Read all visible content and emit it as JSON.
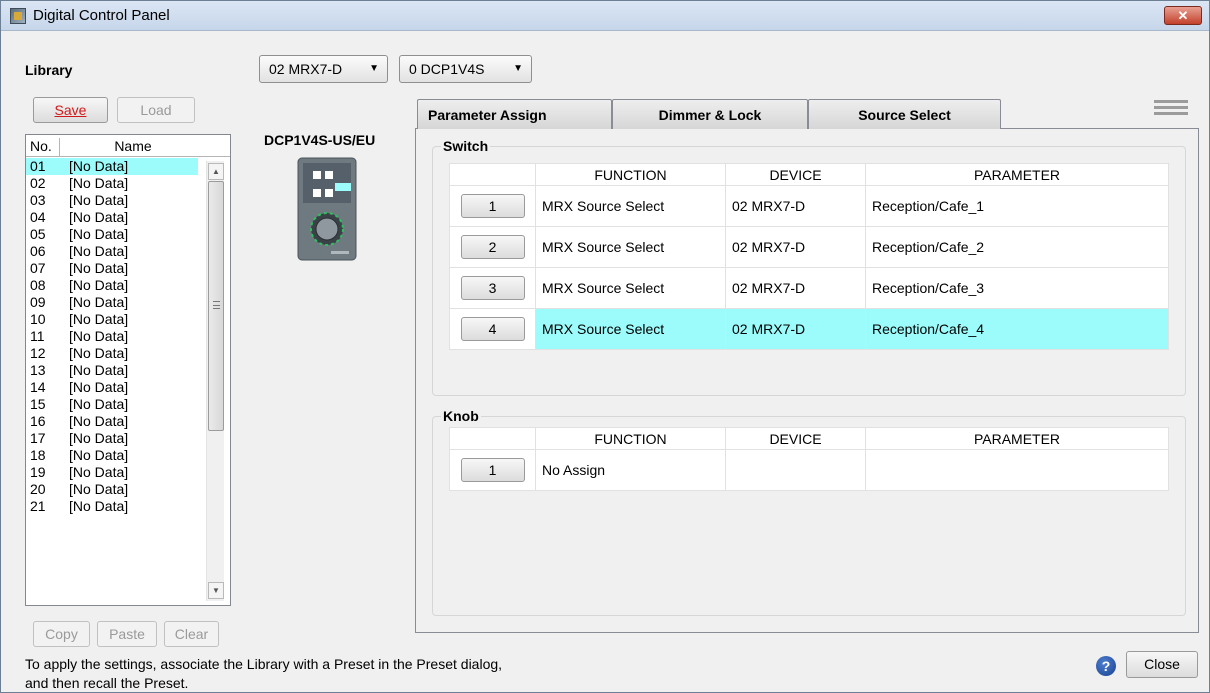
{
  "window": {
    "title": "Digital Control Panel",
    "close_glyph": "✕"
  },
  "library": {
    "label": "Library",
    "save_label": "Save",
    "load_label": "Load",
    "columns": {
      "no": "No.",
      "name": "Name"
    },
    "rows": [
      {
        "no": "01",
        "name": "[No Data]"
      },
      {
        "no": "02",
        "name": "[No Data]"
      },
      {
        "no": "03",
        "name": "[No Data]"
      },
      {
        "no": "04",
        "name": "[No Data]"
      },
      {
        "no": "05",
        "name": "[No Data]"
      },
      {
        "no": "06",
        "name": "[No Data]"
      },
      {
        "no": "07",
        "name": "[No Data]"
      },
      {
        "no": "08",
        "name": "[No Data]"
      },
      {
        "no": "09",
        "name": "[No Data]"
      },
      {
        "no": "10",
        "name": "[No Data]"
      },
      {
        "no": "11",
        "name": "[No Data]"
      },
      {
        "no": "12",
        "name": "[No Data]"
      },
      {
        "no": "13",
        "name": "[No Data]"
      },
      {
        "no": "14",
        "name": "[No Data]"
      },
      {
        "no": "15",
        "name": "[No Data]"
      },
      {
        "no": "16",
        "name": "[No Data]"
      },
      {
        "no": "17",
        "name": "[No Data]"
      },
      {
        "no": "18",
        "name": "[No Data]"
      },
      {
        "no": "19",
        "name": "[No Data]"
      },
      {
        "no": "20",
        "name": "[No Data]"
      },
      {
        "no": "21",
        "name": "[No Data]"
      }
    ],
    "selected_row": "01",
    "copy_label": "Copy",
    "paste_label": "Paste",
    "clear_label": "Clear"
  },
  "selectors": {
    "device": "02 MRX7-D",
    "panel": "0 DCP1V4S"
  },
  "device_preview": {
    "model": "DCP1V4S-US/EU"
  },
  "tabs": [
    {
      "label": "Parameter Assign",
      "active": true
    },
    {
      "label": "Dimmer & Lock",
      "active": false
    },
    {
      "label": "Source Select",
      "active": false
    }
  ],
  "switch_group": {
    "title": "Switch",
    "columns": [
      "FUNCTION",
      "DEVICE",
      "PARAMETER"
    ],
    "rows": [
      {
        "button": "1",
        "function": "MRX Source Select",
        "device": "02 MRX7-D",
        "parameter": "Reception/Cafe_1"
      },
      {
        "button": "2",
        "function": "MRX Source Select",
        "device": "02 MRX7-D",
        "parameter": "Reception/Cafe_2"
      },
      {
        "button": "3",
        "function": "MRX Source Select",
        "device": "02 MRX7-D",
        "parameter": "Reception/Cafe_3"
      },
      {
        "button": "4",
        "function": "MRX Source Select",
        "device": "02 MRX7-D",
        "parameter": "Reception/Cafe_4"
      }
    ],
    "selected_row": "4"
  },
  "knob_group": {
    "title": "Knob",
    "columns": [
      "FUNCTION",
      "DEVICE",
      "PARAMETER"
    ],
    "rows": [
      {
        "button": "1",
        "function": "No Assign",
        "device": "",
        "parameter": ""
      }
    ]
  },
  "footer": {
    "note_line1": "To apply the settings, associate the Library with a Preset in the Preset dialog,",
    "note_line2": "and then recall the Preset.",
    "help_glyph": "?",
    "close_label": "Close"
  },
  "colors": {
    "selection": "#9cfbfb",
    "close_button": "#c2412b"
  }
}
